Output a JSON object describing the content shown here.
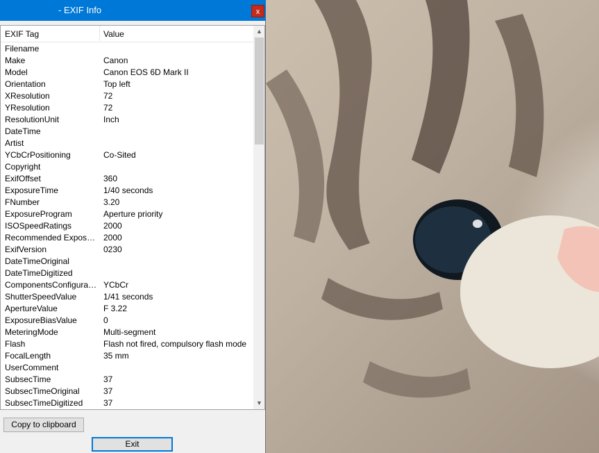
{
  "window": {
    "title": "- EXIF Info",
    "close_label": "x"
  },
  "list": {
    "columns": [
      "EXIF Tag",
      "Value"
    ],
    "rows": [
      {
        "tag": "Filename",
        "value": ""
      },
      {
        "tag": "Make",
        "value": "Canon"
      },
      {
        "tag": "Model",
        "value": "Canon EOS 6D Mark II"
      },
      {
        "tag": "Orientation",
        "value": "Top left"
      },
      {
        "tag": "XResolution",
        "value": "72"
      },
      {
        "tag": "YResolution",
        "value": "72"
      },
      {
        "tag": "ResolutionUnit",
        "value": "Inch"
      },
      {
        "tag": "DateTime",
        "value": ""
      },
      {
        "tag": "Artist",
        "value": ""
      },
      {
        "tag": "YCbCrPositioning",
        "value": "Co-Sited"
      },
      {
        "tag": "Copyright",
        "value": ""
      },
      {
        "tag": "ExifOffset",
        "value": "360"
      },
      {
        "tag": "ExposureTime",
        "value": "1/40 seconds"
      },
      {
        "tag": "FNumber",
        "value": "3.20"
      },
      {
        "tag": "ExposureProgram",
        "value": "Aperture priority"
      },
      {
        "tag": "ISOSpeedRatings",
        "value": "2000"
      },
      {
        "tag": "Recommended Exposure I...",
        "value": "2000"
      },
      {
        "tag": "ExifVersion",
        "value": "0230"
      },
      {
        "tag": "DateTimeOriginal",
        "value": ""
      },
      {
        "tag": "DateTimeDigitized",
        "value": ""
      },
      {
        "tag": "ComponentsConfiguration",
        "value": "YCbCr"
      },
      {
        "tag": "ShutterSpeedValue",
        "value": "1/41 seconds"
      },
      {
        "tag": "ApertureValue",
        "value": "F 3.22"
      },
      {
        "tag": "ExposureBiasValue",
        "value": "0"
      },
      {
        "tag": "MeteringMode",
        "value": "Multi-segment"
      },
      {
        "tag": "Flash",
        "value": "Flash not fired, compulsory flash mode"
      },
      {
        "tag": "FocalLength",
        "value": "35 mm"
      },
      {
        "tag": "UserComment",
        "value": ""
      },
      {
        "tag": "SubsecTime",
        "value": "37"
      },
      {
        "tag": "SubsecTimeOriginal",
        "value": "37"
      },
      {
        "tag": "SubsecTimeDigitized",
        "value": "37"
      }
    ]
  },
  "scrollbar": {
    "up_icon": "▲",
    "down_icon": "▼"
  },
  "buttons": {
    "copy_label": "Copy to clipboard",
    "exit_label": "Exit"
  },
  "colors": {
    "titlebar": "#0078d7",
    "close": "#c42b1c"
  },
  "photo": {
    "icon": "plush-tiger-closeup-image"
  }
}
